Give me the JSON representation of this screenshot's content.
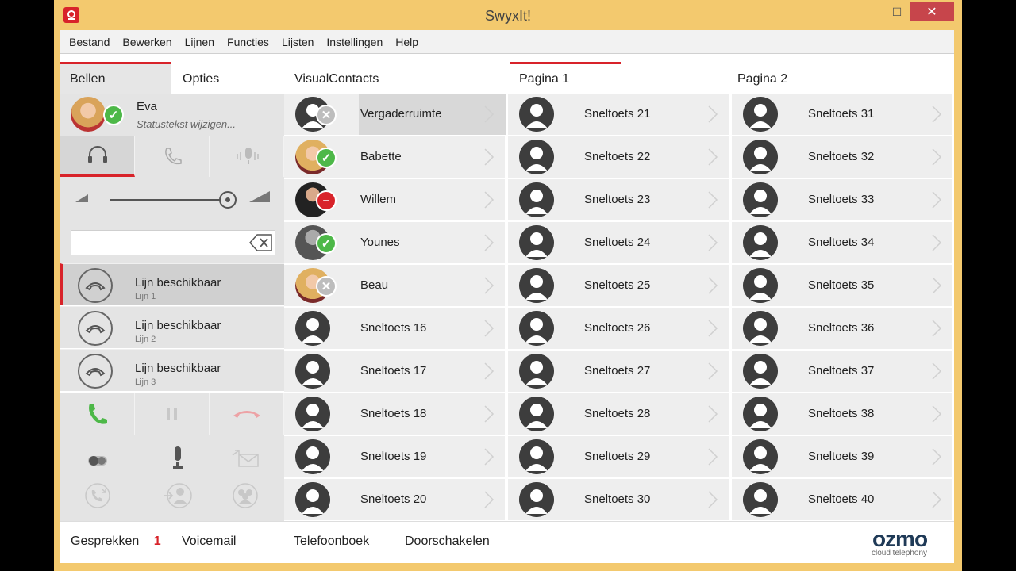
{
  "window": {
    "title": "SwyxIt!",
    "minimize": "—",
    "maximize": "☐",
    "close": "✕"
  },
  "menu": [
    "Bestand",
    "Bewerken",
    "Lijnen",
    "Functies",
    "Lijsten",
    "Instellingen",
    "Help"
  ],
  "left_tabs": {
    "bellen": "Bellen",
    "opties": "Opties"
  },
  "user": {
    "name": "Eva",
    "status_text": "Statustekst wijzigen..."
  },
  "dial": {
    "value": "",
    "placeholder": ""
  },
  "lines": [
    {
      "label": "Lijn beschikbaar",
      "sub": "Lijn 1"
    },
    {
      "label": "Lijn beschikbaar",
      "sub": "Lijn 2"
    },
    {
      "label": "Lijn beschikbaar",
      "sub": "Lijn 3"
    }
  ],
  "visual_contacts": {
    "title": "VisualContacts",
    "items": [
      {
        "label": "Vergaderruimte",
        "status": "gray",
        "avatar": "silhouette"
      },
      {
        "label": "Babette",
        "status": "green",
        "avatar": "photo-blonde"
      },
      {
        "label": "Willem",
        "status": "red",
        "avatar": "photo-man"
      },
      {
        "label": "Younes",
        "status": "green",
        "avatar": "photo-man-bw"
      },
      {
        "label": "Beau",
        "status": "gray",
        "avatar": "photo-blonde"
      },
      {
        "label": "Sneltoets 16",
        "status": "",
        "avatar": "silhouette"
      },
      {
        "label": "Sneltoets 17",
        "status": "",
        "avatar": "silhouette"
      },
      {
        "label": "Sneltoets 18",
        "status": "",
        "avatar": "silhouette"
      },
      {
        "label": "Sneltoets 19",
        "status": "",
        "avatar": "silhouette"
      },
      {
        "label": "Sneltoets 20",
        "status": "",
        "avatar": "silhouette"
      }
    ]
  },
  "pages": {
    "pagina1": "Pagina 1",
    "pagina2": "Pagina 2"
  },
  "page1_keys": [
    "Sneltoets 21",
    "Sneltoets 22",
    "Sneltoets 23",
    "Sneltoets 24",
    "Sneltoets 25",
    "Sneltoets 26",
    "Sneltoets 27",
    "Sneltoets 28",
    "Sneltoets 29",
    "Sneltoets 30"
  ],
  "page2_keys": [
    "Sneltoets 31",
    "Sneltoets 32",
    "Sneltoets 33",
    "Sneltoets 34",
    "Sneltoets 35",
    "Sneltoets 36",
    "Sneltoets 37",
    "Sneltoets 38",
    "Sneltoets 39",
    "Sneltoets 40"
  ],
  "footer": {
    "gesprekken": "Gesprekken",
    "gesprekken_count": "1",
    "voicemail": "Voicemail",
    "telefoonboek": "Telefoonboek",
    "doorschakelen": "Doorschakelen"
  },
  "logo": {
    "main": "ozmo",
    "sub": "cloud telephony"
  },
  "colors": {
    "accent": "#d8232a",
    "online": "#4db848",
    "title_bar": "#f3c96e",
    "brand": "#1f3a57"
  }
}
